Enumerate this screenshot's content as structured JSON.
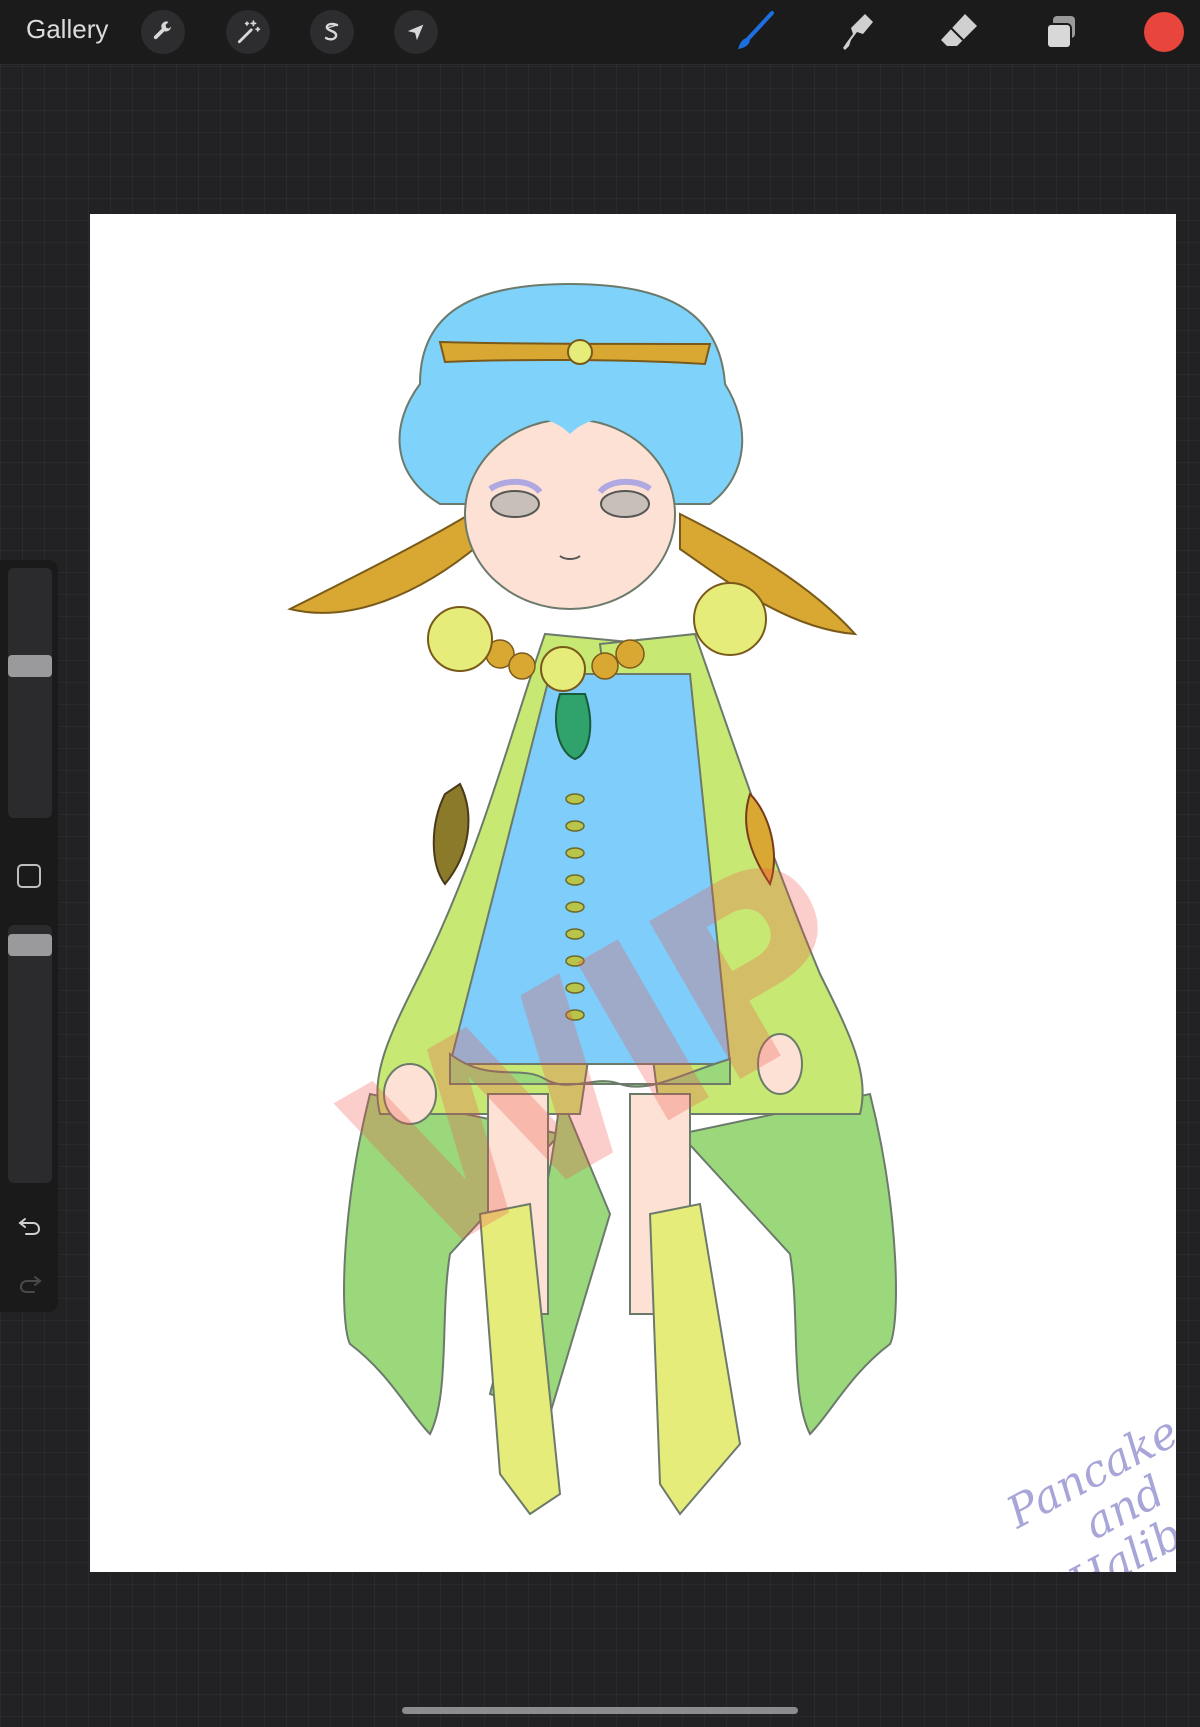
{
  "app": {
    "gallery_label": "Gallery",
    "accent_color": "#1d6fe0",
    "current_color": "#e8463c"
  },
  "toolbar_left": [
    {
      "name": "actions",
      "icon": "wrench-icon"
    },
    {
      "name": "adjustments",
      "icon": "magic-wand-icon"
    },
    {
      "name": "selection",
      "icon": "selection-s-icon"
    },
    {
      "name": "transform",
      "icon": "arrow-cursor-icon"
    }
  ],
  "toolbar_right": [
    {
      "name": "brush",
      "icon": "brush-icon",
      "active": true
    },
    {
      "name": "smudge",
      "icon": "smudge-icon",
      "active": false
    },
    {
      "name": "eraser",
      "icon": "eraser-icon",
      "active": false
    },
    {
      "name": "layers",
      "icon": "layers-icon",
      "active": false
    }
  ],
  "sidebar": {
    "brush_size_level": 0.62,
    "opacity_level": 0.96,
    "undo_icon": "undo-icon",
    "redo_icon": "redo-icon",
    "redo_enabled": false
  },
  "artwork": {
    "watermark_text": "WIP",
    "signature_text": "Pancakes\nand\nHalibut",
    "colors": {
      "hair": "#7fd3fb",
      "skin": "#fde1d5",
      "cape": "#c8e874",
      "cape_lower": "#9bd87c",
      "dress": "#7fcdfa",
      "gold": "#d8a833",
      "boots": "#e6ec7a",
      "signature": "#a8a6d8",
      "watermark": "#f07068"
    }
  }
}
